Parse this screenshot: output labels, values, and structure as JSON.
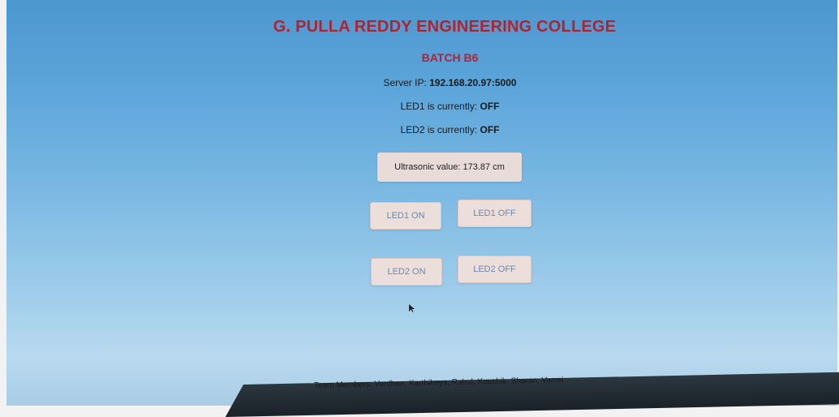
{
  "header": {
    "title": "G. PULLA REDDY ENGINEERING COLLEGE",
    "subtitle": "BATCH B6"
  },
  "status": {
    "server_ip_label": "Server IP: ",
    "server_ip_value": "192.168.20.97:5000",
    "led1_label": "LED1 is currently: ",
    "led1_value": "OFF",
    "led2_label": "LED2 is currently: ",
    "led2_value": "OFF"
  },
  "sensor": {
    "ultrasonic_text": "Ultrasonic value: 173.87 cm"
  },
  "controls": {
    "led1_on": "LED1 ON",
    "led1_off": "LED1 OFF",
    "led2_on": "LED2 ON",
    "led2_off": "LED2 OFF"
  },
  "footer": {
    "team": "Team Members: Vardhan, Karthikeya, Rahul, Koushik, Sharan, Vamsi"
  },
  "colors": {
    "heading": "#b22330",
    "button_bg": "#ecdedb",
    "button_text": "#6e86a8"
  }
}
